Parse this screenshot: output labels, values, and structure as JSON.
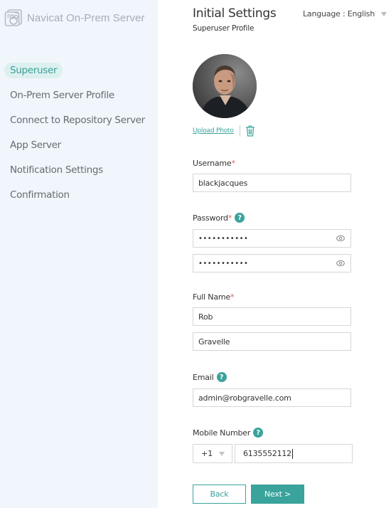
{
  "app": {
    "name": "Navicat On-Prem Server"
  },
  "sidebar": {
    "items": [
      {
        "label": "Superuser",
        "active": true
      },
      {
        "label": "On-Prem Server Profile",
        "active": false
      },
      {
        "label": "Connect to Repository Server",
        "active": false
      },
      {
        "label": "App Server",
        "active": false
      },
      {
        "label": "Notification Settings",
        "active": false
      },
      {
        "label": "Confirmation",
        "active": false
      }
    ]
  },
  "header": {
    "title": "Initial Settings",
    "subtitle": "Superuser Profile",
    "language_label": "Language : English"
  },
  "photo": {
    "upload_label": "Upload Photo"
  },
  "form": {
    "username": {
      "label": "Username",
      "required": "*",
      "value": "blackjacques"
    },
    "password": {
      "label": "Password",
      "required": "*",
      "help": "?",
      "value": "•••••••••••",
      "confirm_value": "•••••••••••"
    },
    "fullname": {
      "label": "Full Name",
      "required": "*",
      "first": "Rob",
      "last": "Gravelle"
    },
    "email": {
      "label": "Email",
      "help": "?",
      "value": "admin@robgravelle.com"
    },
    "mobile": {
      "label": "Mobile Number",
      "help": "?",
      "country_code": "+1",
      "value": "6135552112"
    }
  },
  "buttons": {
    "back": "Back",
    "next": "Next >"
  },
  "colors": {
    "accent": "#3aa39b",
    "required": "#e05a5a",
    "sidebar_bg": "#f1f6fc",
    "active_pill": "#dcf0ef"
  }
}
